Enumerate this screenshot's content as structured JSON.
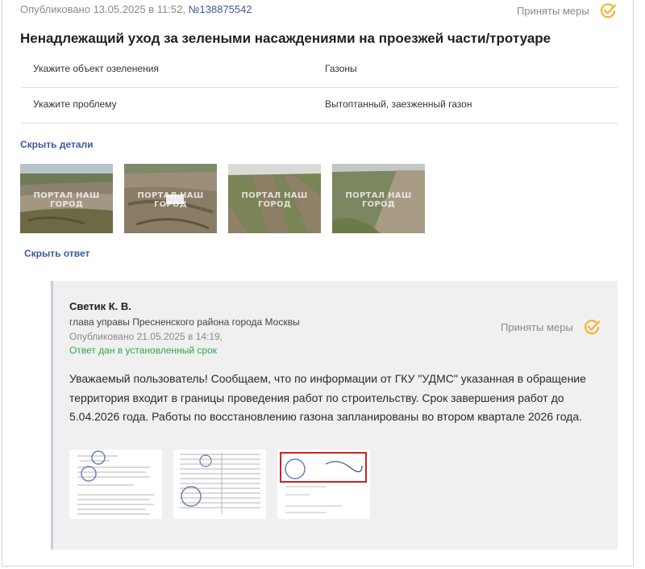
{
  "post": {
    "published_prefix": "Опубликовано 13.05.2025 в 11:52, ",
    "number": "№138875542",
    "status": "Приняты меры",
    "title": "Ненадлежащий уход за зелеными насаждениями на проезжей части/тротуаре",
    "details": [
      {
        "label": "Укажите объект озеленения",
        "value": "Газоны"
      },
      {
        "label": "Укажите проблему",
        "value": "Вытоптанный, заезженный газон"
      }
    ],
    "hide_details": "Скрыть детали",
    "photos_watermark": "ПОРТАЛ НАШ ГОРОД",
    "hide_answer": "Скрыть ответ"
  },
  "answer": {
    "author": "Светик К. В.",
    "position": "глава управы Пресненского района города Москвы",
    "published": "Опубликовано 21.05.2025 в 14:19,",
    "ontime": "Ответ дан в установленный срок",
    "status": "Приняты меры",
    "text": "Уважаемый пользователь! Сообщаем, что по информации от ГКУ \"УДМС\" указанная в обращение территория входит в границы проведения работ по строительству. Срок завершения работ до 5.04.2026 года. Работы по восстановлению газона запланированы во втором квартале 2026 года."
  },
  "colors": {
    "link": "#3e5a9c",
    "status_check": "#f2b632",
    "ontime": "#2fa84f"
  }
}
